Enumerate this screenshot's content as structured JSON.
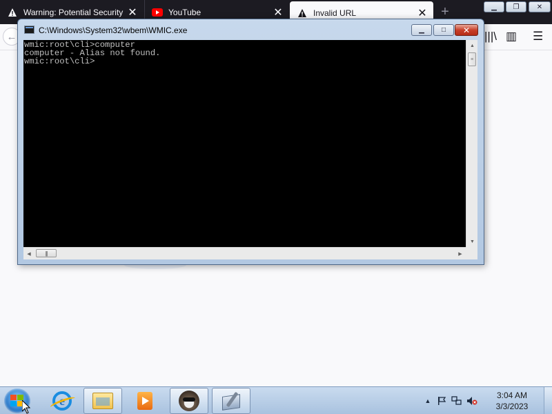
{
  "browser": {
    "tabs": [
      {
        "label": "Warning: Potential Security Risk Ahead",
        "icon": "warning-icon",
        "active": false
      },
      {
        "label": "YouTube",
        "icon": "youtube-icon",
        "active": false
      },
      {
        "label": "Invalid URL",
        "icon": "warning-icon",
        "active": true
      }
    ],
    "new_tab_symbol": "+",
    "tab_close_symbol": "✕",
    "back_symbol": "←",
    "library_symbol": "|||\\",
    "sidebar_symbol": "▥",
    "menu_symbol": "☰"
  },
  "console": {
    "title": "C:\\Windows\\System32\\wbem\\WMIC.exe",
    "lines": [
      "wmic:root\\cli>computer",
      "computer - Alias not found.",
      "wmic:root\\cli>"
    ],
    "colors": {
      "background": "#000000",
      "text": "#c0c0c0"
    }
  },
  "taskbar": {
    "pinned": [
      {
        "name": "internet-explorer",
        "icon": "ie-icon"
      },
      {
        "name": "windows-explorer",
        "icon": "folder-icon"
      },
      {
        "name": "media-player",
        "icon": "media-icon"
      },
      {
        "name": "tool-app",
        "icon": "raccoon-icon"
      },
      {
        "name": "wmic",
        "icon": "wmic-icon"
      }
    ],
    "clock": {
      "time": "3:04 AM",
      "date": "3/3/2023"
    }
  }
}
